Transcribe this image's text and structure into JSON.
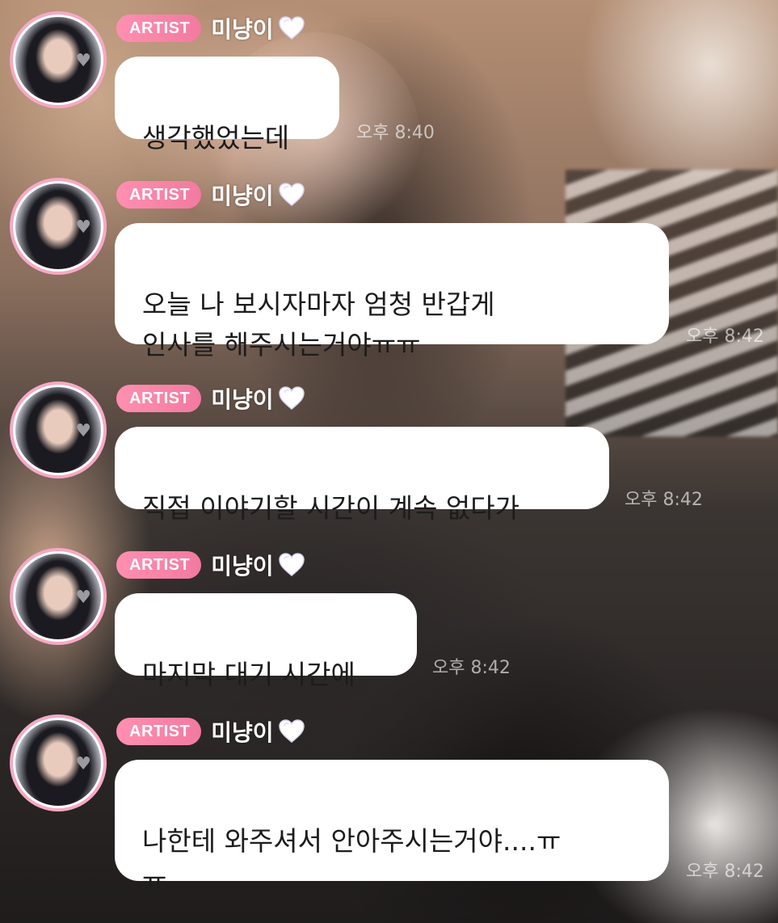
{
  "artist_badge_label": "ARTIST",
  "sender_name": "미냥이",
  "messages": [
    {
      "text": "생각했었는데",
      "time": "오후 8:40"
    },
    {
      "text": "오늘 나 보시자마자 엄청 반갑게\n인사를 해주시는거야ㅠㅠ",
      "time": "오후 8:42"
    },
    {
      "text": "직접 이야기할 시간이 계속 없다가",
      "time": "오후 8:42"
    },
    {
      "text": "마지막 대기 시간에",
      "time": "오후 8:42"
    },
    {
      "text": "나한테 와주셔서 안아주시는거야....ㅠ\nㅠ",
      "time": "오후 8:42"
    }
  ],
  "colors": {
    "badge_pink": "#f27aa0",
    "avatar_ring": "#f6a9c4",
    "bubble_bg": "#ffffff",
    "heart_lavender": "#d9d2ee"
  },
  "icons": {
    "heart_after_name": "white-heart-icon",
    "avatar_overlay": "grey-heart-icon"
  }
}
